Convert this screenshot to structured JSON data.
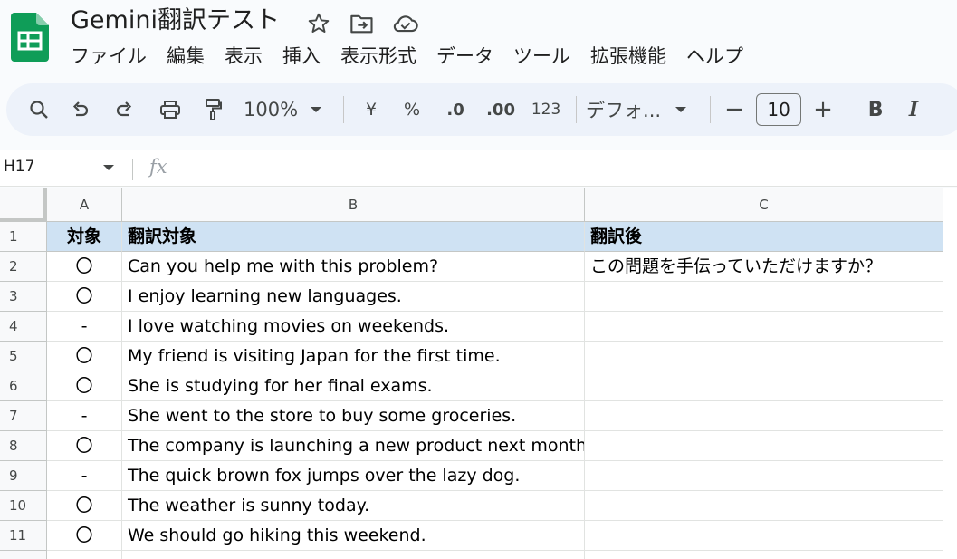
{
  "document": {
    "title": "Gemini翻訳テスト"
  },
  "icons": {
    "logo": "google-sheets-logo",
    "star": "star-icon",
    "move": "move-to-folder-icon",
    "cloud": "cloud-saved-icon"
  },
  "menu": [
    {
      "label": "ファイル"
    },
    {
      "label": "編集"
    },
    {
      "label": "表示"
    },
    {
      "label": "挿入"
    },
    {
      "label": "表示形式"
    },
    {
      "label": "データ"
    },
    {
      "label": "ツール"
    },
    {
      "label": "拡張機能"
    },
    {
      "label": "ヘルプ"
    }
  ],
  "toolbar": {
    "zoom": "100%",
    "currency": "¥",
    "percent": "%",
    "decrease_decimal": ".0",
    "increase_decimal": ".00",
    "number_format": "123",
    "font_name": "デフォ...",
    "font_size": "10",
    "minus": "−",
    "plus": "+",
    "bold": "B",
    "italic": "I"
  },
  "formula_bar": {
    "cell_ref": "H17",
    "fx": "fx",
    "value": ""
  },
  "columns": [
    "A",
    "B",
    "C"
  ],
  "rows": [
    {
      "num": "1",
      "a": "対象",
      "b": "翻訳対象",
      "c": "翻訳後"
    },
    {
      "num": "2",
      "a": "〇",
      "b": "Can you help me with this problem?",
      "c": "この問題を手伝っていただけますか？"
    },
    {
      "num": "3",
      "a": "〇",
      "b": "I enjoy learning new languages.",
      "c": ""
    },
    {
      "num": "4",
      "a": "-",
      "b": "I love watching movies on weekends.",
      "c": ""
    },
    {
      "num": "5",
      "a": "〇",
      "b": "My friend is visiting Japan for the first time.",
      "c": ""
    },
    {
      "num": "6",
      "a": "〇",
      "b": "She is studying for her final exams.",
      "c": ""
    },
    {
      "num": "7",
      "a": "-",
      "b": "She went to the store to buy some groceries.",
      "c": ""
    },
    {
      "num": "8",
      "a": "〇",
      "b": "The company is launching a new product next month.",
      "c": ""
    },
    {
      "num": "9",
      "a": "-",
      "b": "The quick brown fox jumps over the lazy dog.",
      "c": ""
    },
    {
      "num": "10",
      "a": "〇",
      "b": "The weather is sunny today.",
      "c": ""
    },
    {
      "num": "11",
      "a": "〇",
      "b": "We should go hiking this weekend.",
      "c": ""
    },
    {
      "num": "",
      "a": "",
      "b": "",
      "c": ""
    }
  ],
  "colors": {
    "header_row_fill": "#cfe2f3",
    "toolbar_bg": "#edf2fa",
    "sheets_green": "#0f9d58"
  }
}
